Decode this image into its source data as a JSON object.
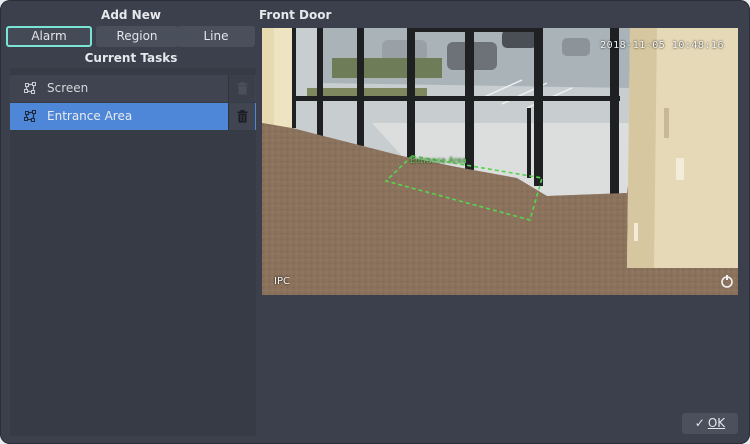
{
  "left": {
    "add_new_title": "Add New",
    "tabs": [
      {
        "label": "Alarm"
      },
      {
        "label": "Region"
      },
      {
        "label": "Line"
      }
    ],
    "current_tasks_title": "Current Tasks",
    "tasks": [
      {
        "label": "Screen",
        "icon": "region-icon",
        "selected": false
      },
      {
        "label": "Entrance Area",
        "icon": "region-icon",
        "selected": true
      }
    ]
  },
  "camera": {
    "title": "Front Door",
    "timestamp": "2018-11-05 10:48:16",
    "watermark": "IPC",
    "zone_label": "Entrance Area",
    "zone_color": "#58d44f"
  },
  "footer": {
    "ok_label": "OK"
  },
  "colors": {
    "background": "#3b404c",
    "selected_row": "#4f87d8",
    "focus_ring": "#7be4d6"
  }
}
